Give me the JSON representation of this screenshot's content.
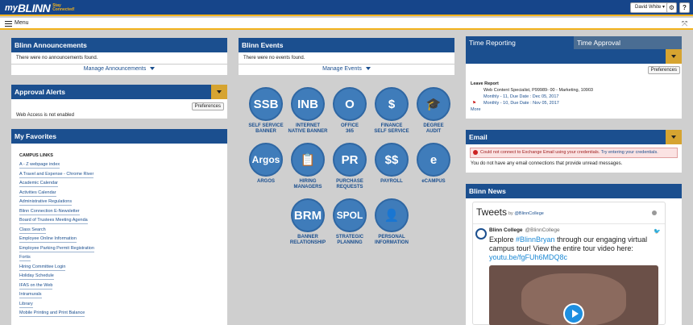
{
  "header": {
    "logo_my": "my",
    "logo_blinn": "BLINN",
    "logo_tagline": "Stay Connected!",
    "user_menu": "David White ▾",
    "settings_icon": "gear-icon",
    "help_label": "?"
  },
  "menubar": {
    "menu_label": "Menu"
  },
  "announcements": {
    "title": "Blinn Announcements",
    "message": "There were no announcements found.",
    "manage": "Manage Announcements"
  },
  "events": {
    "title": "Blinn Events",
    "message": "There were no events found.",
    "manage": "Manage Events"
  },
  "approval": {
    "title": "Approval Alerts",
    "preferences": "Preferences",
    "message": "Web Access is not enabled"
  },
  "favorites": {
    "title": "My Favorites",
    "section": "CAMPUS LINKS",
    "items": [
      "A - Z webpage index",
      "A Travel and Expense - Chrome River",
      "Academic Calendar",
      "Activities Calendar",
      "Administrative Regulations",
      "Blinn Connection E-Newsletter",
      "Board of Trustees Meeting Agenda",
      "Class Search",
      "Employee Online Information",
      "Employee Parking Permit Registration",
      "Fortis",
      "Hiring Committee Login",
      "Holiday Schedule",
      "IFAS on the Web",
      "Intramurals",
      "Library",
      "Mobile Printing and Print Balance"
    ]
  },
  "apps": [
    {
      "glyph": "SSB",
      "label": "SELF SERVICE\nBANNER"
    },
    {
      "glyph": "INB",
      "label": "INTERNET\nNATIVE BANNER"
    },
    {
      "glyph": "O",
      "label": "OFFICE\n365"
    },
    {
      "glyph": "$",
      "label": "FINANCE\nSELF SERVICE"
    },
    {
      "glyph": "🎓",
      "label": "DEGREE\nAUDIT"
    },
    {
      "glyph": "Argos",
      "label": "ARGOS"
    },
    {
      "glyph": "📋",
      "label": "HIRING\nMANAGERS"
    },
    {
      "glyph": "PR",
      "label": "PURCHASE\nREQUESTS"
    },
    {
      "glyph": "$$",
      "label": "PAYROLL"
    },
    {
      "glyph": "e",
      "label": "eCAMPUS"
    },
    {
      "glyph": "BRM",
      "label": "BANNER\nRELATIONSHIP"
    },
    {
      "glyph": "SPOL",
      "label": "STRATEGIC\nPLANNING"
    },
    {
      "glyph": "👤",
      "label": "PERSONAL\nINFORMATION"
    }
  ],
  "time": {
    "tab_reporting": "Time Reporting",
    "tab_approval": "Time Approval",
    "preferences": "Preferences",
    "report_title": "Leave Report",
    "position": "Web Content Specialist,  P99989- 00  -  Marketing, 10903",
    "entry1": "Monthly - 11, Due Date : Dec 05, 2017",
    "entry2": "Monthly - 10, Due Date : Nov 05, 2017",
    "more": "More"
  },
  "email": {
    "title": "Email",
    "error": "Could not connect to Exchange Email using your credentials.",
    "error_link": "Try entering your credentials.",
    "message": "You do not have any email connections that provide unread messages."
  },
  "news": {
    "title": "Blinn News",
    "tweets_title": "Tweets",
    "tweets_by": "by",
    "tweets_handle": "@BlinnCollege",
    "tweet_name": "Blinn College",
    "tweet_handle": "@BlinnCollege",
    "tweet_pre": "Explore ",
    "tweet_hashtag": "#BlinnBryan",
    "tweet_post": " through our engaging virtual campus tour! View the entire tour video here: ",
    "tweet_url": "youtu.be/fgFUh6MDQ8c"
  },
  "colors": {
    "brand_blue": "#1b4f8f",
    "gold": "#f2b21c",
    "tile_blue": "#3f7cba"
  }
}
